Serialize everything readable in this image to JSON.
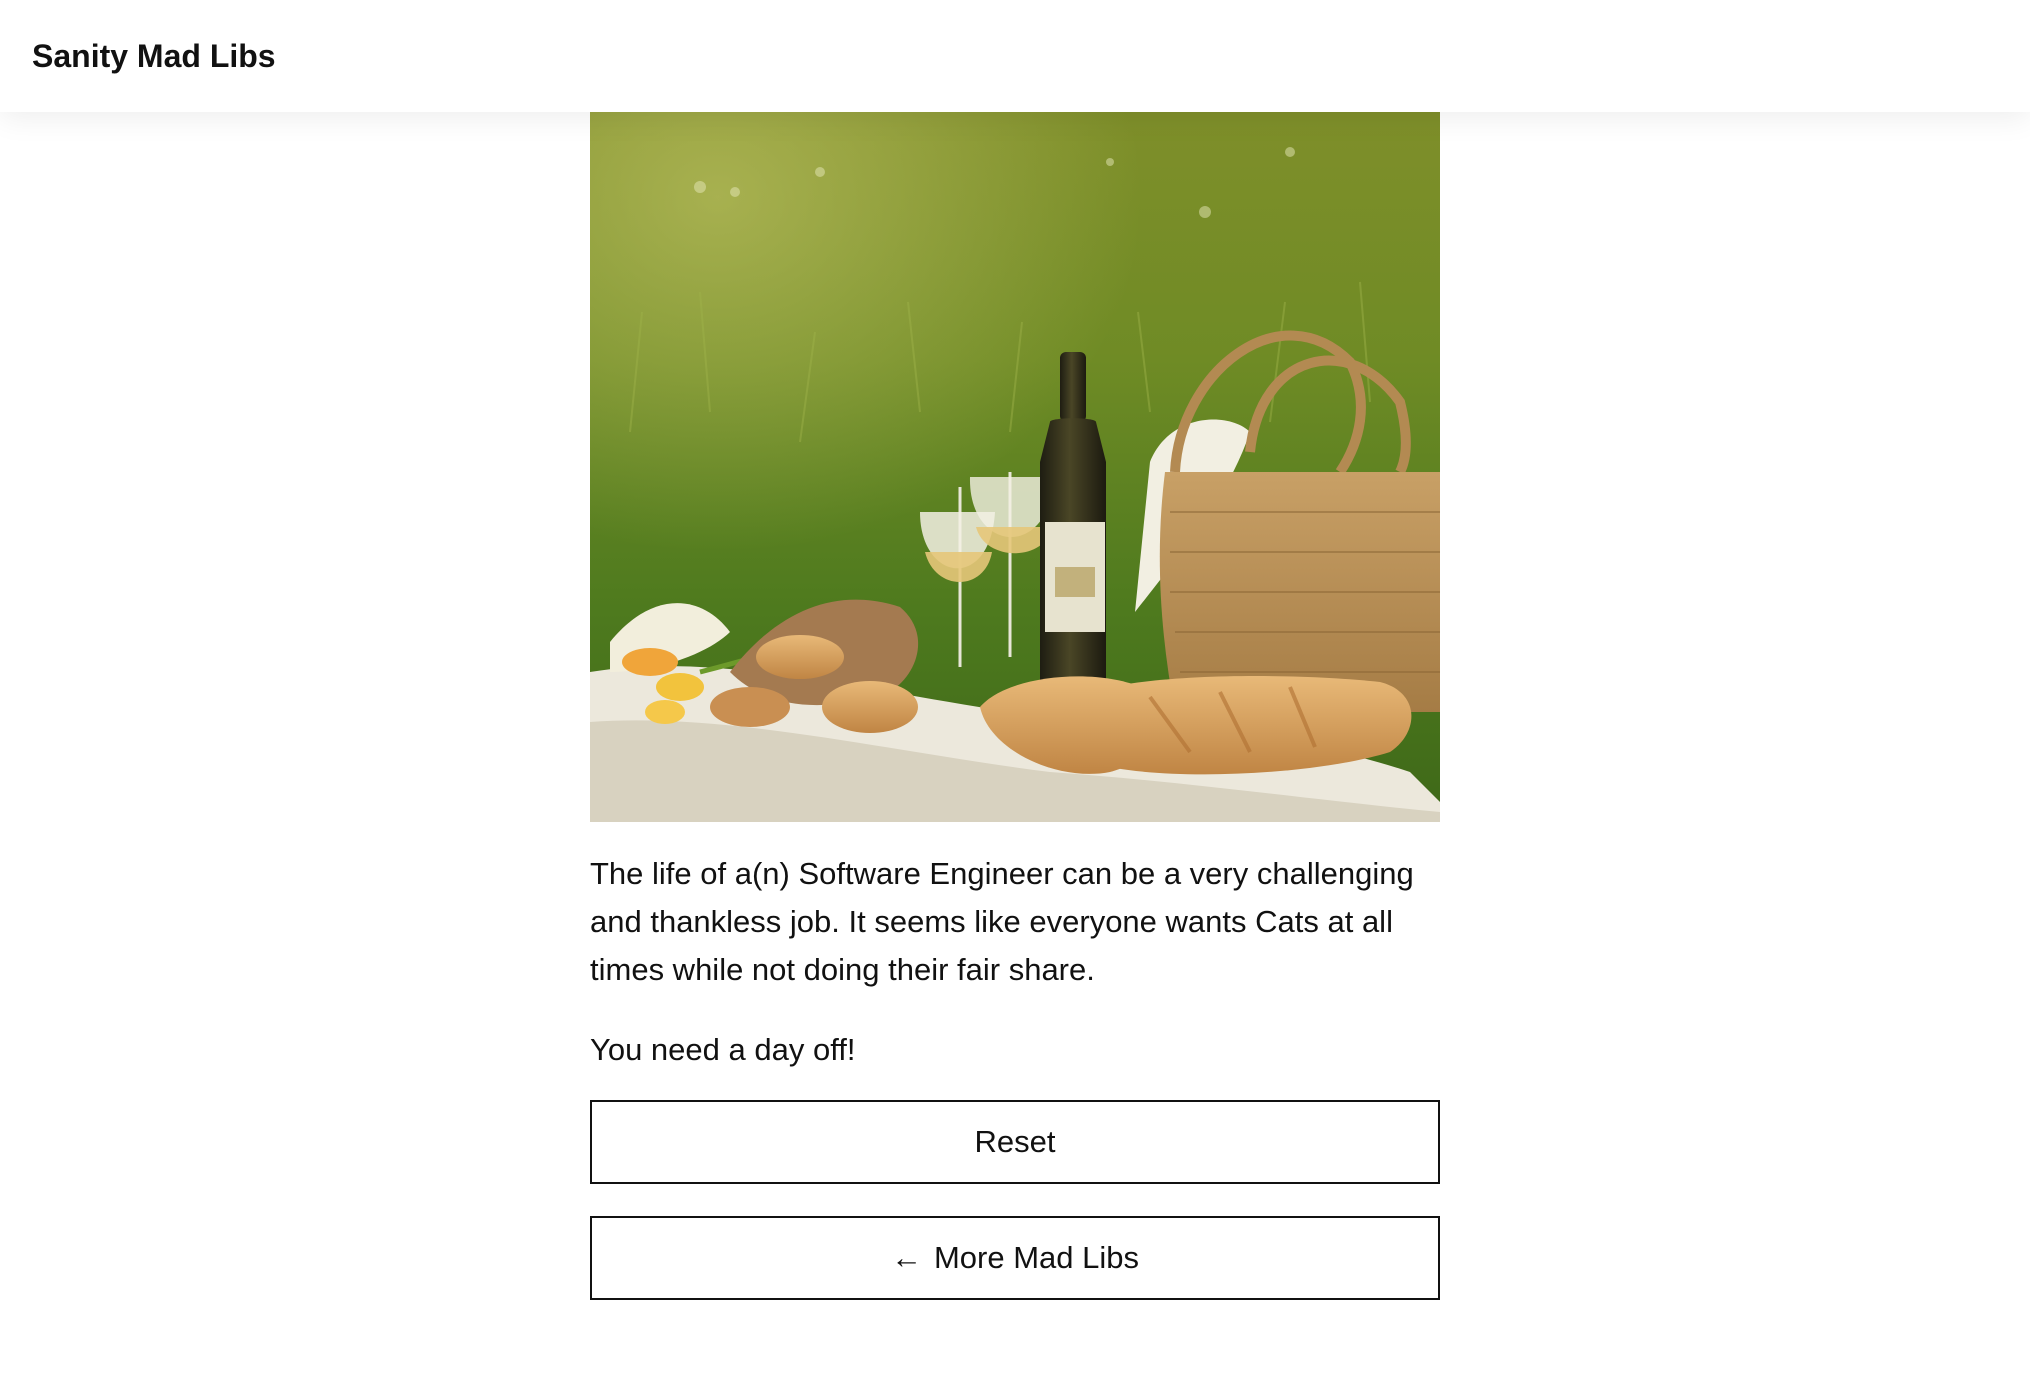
{
  "header": {
    "title": "Sanity Mad Libs"
  },
  "hero_image": {
    "alt": "Picnic on grass with wine, glasses, bread and a woven basket"
  },
  "story": {
    "paragraph": "The life of a(n) Software Engineer can be a very challenging and thankless job. It seems like everyone wants Cats at all times while not doing their fair share.",
    "outro": "You need a day off!"
  },
  "actions": {
    "reset_label": "Reset",
    "more_arrow": "←",
    "more_label": "More Mad Libs"
  }
}
